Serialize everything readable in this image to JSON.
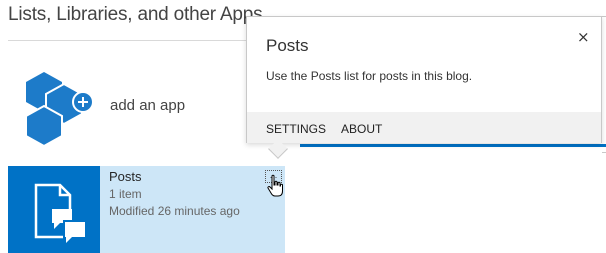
{
  "section": {
    "heading": "Lists, Libraries, and other Apps"
  },
  "add_app": {
    "label": "add an app",
    "icon": "add-app-icon"
  },
  "app_tile": {
    "title": "Posts",
    "item_count": "1 item",
    "modified": "Modified 26 minutes ago",
    "ellipsis": "...",
    "icon": "posts-list-icon"
  },
  "callout": {
    "title": "Posts",
    "close_glyph": "×",
    "description": "Use the Posts list for posts in this blog.",
    "actions": {
      "settings": "SETTINGS",
      "about": "ABOUT"
    }
  },
  "colors": {
    "accent": "#0072c6",
    "tile_selected": "#cde6f7",
    "add_app_blue": "#1d7bc9"
  }
}
